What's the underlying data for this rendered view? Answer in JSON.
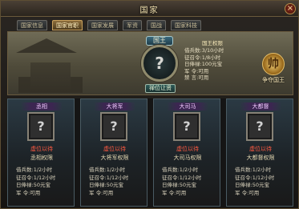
{
  "window": {
    "title": "国家",
    "close": "×"
  },
  "tabs": [
    {
      "label": "国家信息"
    },
    {
      "label": "国家官职",
      "active": true
    },
    {
      "label": "国家发展"
    },
    {
      "label": "军资"
    },
    {
      "label": "国战"
    },
    {
      "label": "国家科技"
    }
  ],
  "king": {
    "label": "国王",
    "portrait": "?",
    "abdicate_button": "禅位让贤",
    "perm_title": "国王权限",
    "perms": [
      "借兵数:3/10小时",
      "征召令:1/8小时",
      "日俸禄:100元宝",
      "军  令:可用",
      "禁  言:可用"
    ],
    "seize_label": "争夺国王",
    "seize_icon": "帅"
  },
  "officers": [
    {
      "title": "丞相",
      "slot": "?",
      "status": "虚位以待",
      "perm_title": "丞相权限",
      "lines": [
        "借兵数:1/2小时",
        "征召令:1/12小时",
        "日俸禄:50元宝",
        "军  令:可用"
      ]
    },
    {
      "title": "大将军",
      "slot": "?",
      "status": "虚位以待",
      "perm_title": "大将军权限",
      "lines": [
        "借兵数:1/2小时",
        "征召令:1/12小时",
        "日俸禄:50元宝",
        "军  令:可用"
      ]
    },
    {
      "title": "大司马",
      "slot": "?",
      "status": "虚位以待",
      "perm_title": "大司马权限",
      "lines": [
        "借兵数:1/2小时",
        "征召令:1/12小时",
        "日俸禄:50元宝",
        "军  令:可用"
      ]
    },
    {
      "title": "大都督",
      "slot": "?",
      "status": "虚位以待",
      "perm_title": "大都督权限",
      "lines": [
        "借兵数:1/2小时",
        "征召令:1/12小时",
        "日俸禄:50元宝",
        "军  令:可用"
      ]
    }
  ]
}
